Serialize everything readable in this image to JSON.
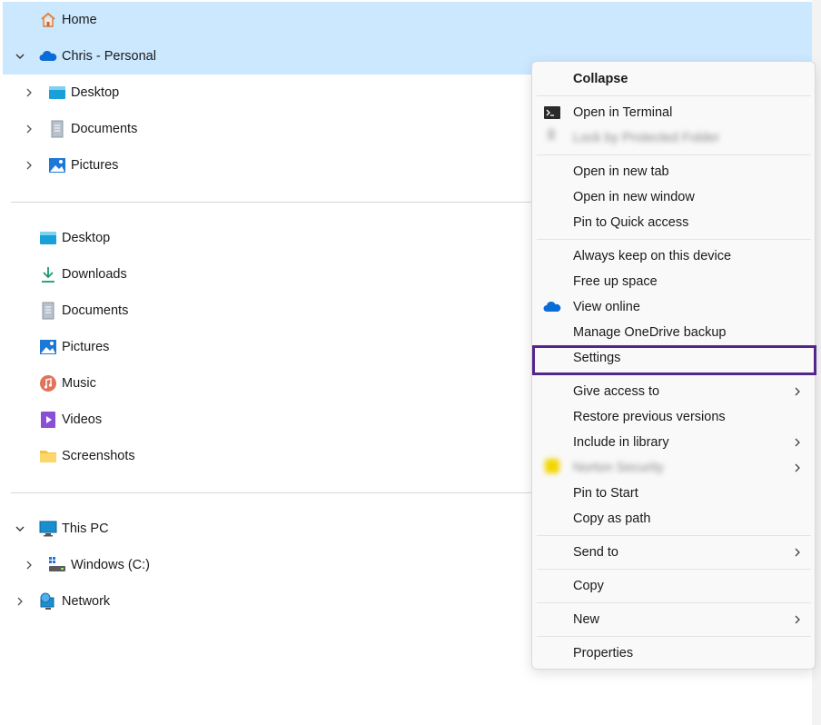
{
  "nav": {
    "home": "Home",
    "onedrive": "Chris - Personal",
    "od_children": [
      "Desktop",
      "Documents",
      "Pictures"
    ],
    "quick": [
      "Desktop",
      "Downloads",
      "Documents",
      "Pictures",
      "Music",
      "Videos",
      "Screenshots"
    ],
    "this_pc": "This PC",
    "drive_c": "Windows (C:)",
    "network": "Network"
  },
  "menu": {
    "collapse": "Collapse",
    "open_terminal": "Open in Terminal",
    "lock_folder": "Lock by Protected Folder",
    "open_new_tab": "Open in new tab",
    "open_new_window": "Open in new window",
    "pin_quick": "Pin to Quick access",
    "always_keep": "Always keep on this device",
    "free_space": "Free up space",
    "view_online": "View online",
    "manage_backup": "Manage OneDrive backup",
    "settings": "Settings",
    "give_access": "Give access to",
    "restore": "Restore previous versions",
    "include_library": "Include in library",
    "norton": "Norton Security",
    "pin_start": "Pin to Start",
    "copy_path": "Copy as path",
    "send_to": "Send to",
    "copy": "Copy",
    "new": "New",
    "properties": "Properties"
  },
  "colors": {
    "selection": "#cce8ff",
    "highlight_border": "#55258e",
    "onedrive_blue": "#0a6cd6"
  }
}
